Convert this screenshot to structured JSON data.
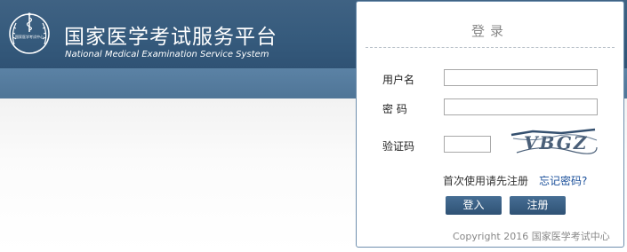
{
  "header": {
    "title": "国家医学考试服务平台",
    "subtitle": "National Medical Examination Service System",
    "logo_text": "国家医学考试中心"
  },
  "login": {
    "title": "登录",
    "username_label": "用户名",
    "username_value": "",
    "password_label": "密 码",
    "password_value": "",
    "captcha_label": "验证码",
    "captcha_value": "",
    "captcha_text": "VBGZ",
    "first_use_hint": "首次使用请先注册",
    "forgot_password_link": "忘记密码?",
    "login_button": "登入",
    "register_button": "注册",
    "copyright": "Copyright 2016 国家医学考试中心"
  },
  "colors": {
    "header": "#355a7c",
    "subband": "#557b9e",
    "button": "#3a5f84",
    "link": "#1a4f9a"
  }
}
